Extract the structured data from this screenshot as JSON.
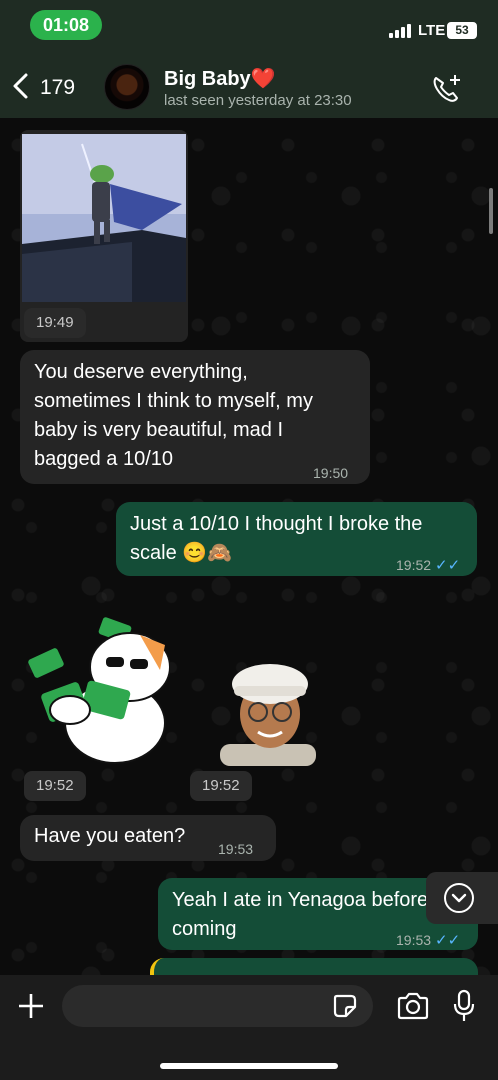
{
  "status_bar": {
    "time": "01:08",
    "network": "LTE",
    "battery": "53"
  },
  "header": {
    "back_count": "179",
    "contact_name": "Big Baby",
    "contact_emoji": "❤️",
    "last_seen": "last seen yesterday at 23:30",
    "icons": {
      "back": "chevron-left-icon",
      "call": "add-call-icon"
    }
  },
  "messages": [
    {
      "type": "image",
      "direction": "incoming",
      "time": "19:49",
      "description_icon": "image"
    },
    {
      "type": "text",
      "direction": "incoming",
      "text": "You deserve everything, sometimes I think to myself, my baby is very beautiful, mad I bagged a 10/10",
      "time": "19:50"
    },
    {
      "type": "text",
      "direction": "outgoing",
      "text": "Just a 10/10 I thought I broke the scale 😊🙈",
      "time": "19:52",
      "status": "read"
    },
    {
      "type": "sticker",
      "direction": "incoming",
      "time": "19:52",
      "icon": "cat-money-sticker"
    },
    {
      "type": "sticker",
      "direction": "incoming",
      "time": "19:52",
      "icon": "avatar-cap-sticker"
    },
    {
      "type": "text",
      "direction": "incoming",
      "text": "Have you eaten?",
      "time": "19:53"
    },
    {
      "type": "text",
      "direction": "outgoing",
      "text": "Yeah I ate in Yenagoa before coming",
      "time": "19:53",
      "status": "read"
    }
  ],
  "input_bar": {
    "placeholder": "",
    "icons": [
      "plus-icon",
      "sticker-icon",
      "camera-icon",
      "mic-icon"
    ]
  },
  "colors": {
    "header_bg": "#1f2c23",
    "incoming_bubble": "#252525",
    "outgoing_bubble": "#144d37",
    "read_ticks": "#58b6ff",
    "time_pill": "#2bb24c"
  }
}
